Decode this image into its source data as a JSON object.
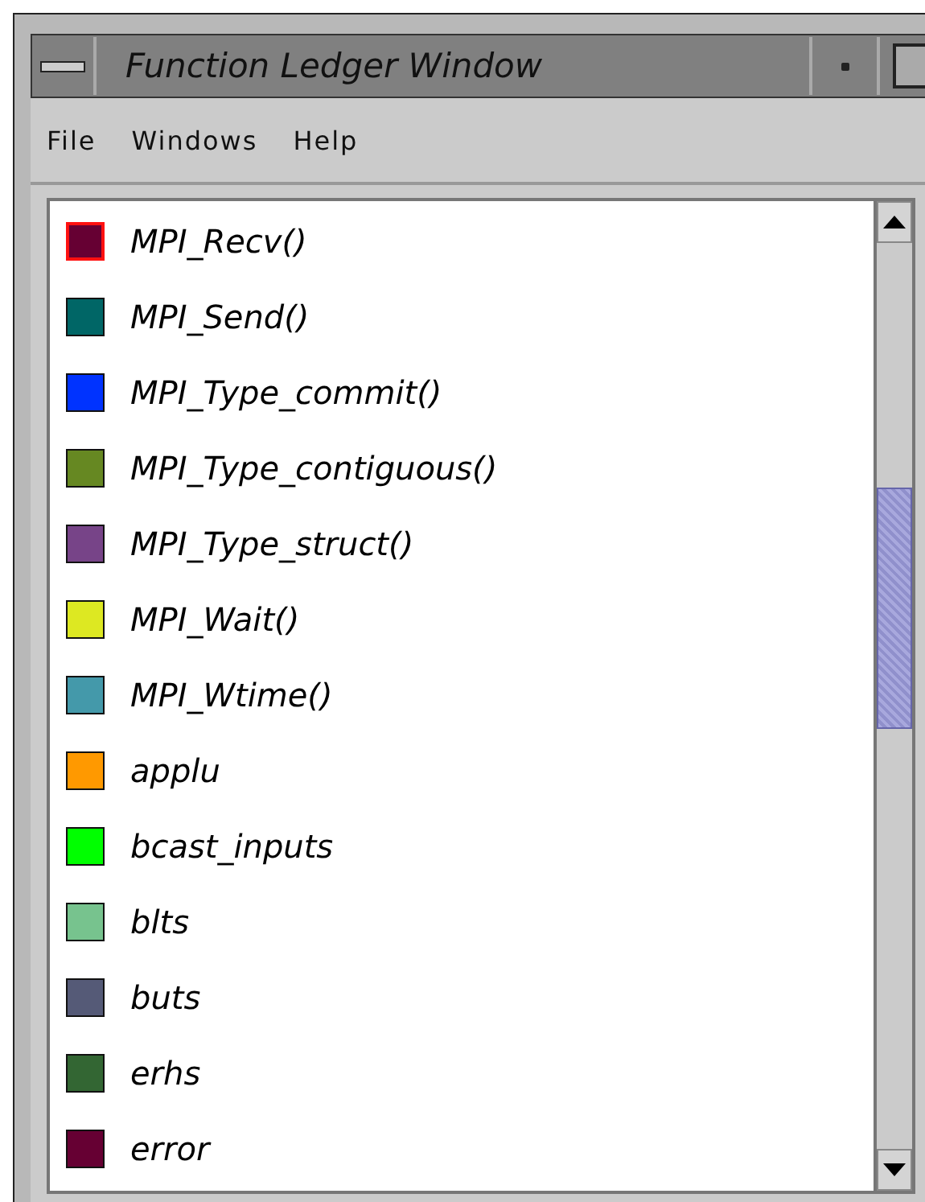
{
  "window": {
    "title": "Function Ledger Window"
  },
  "menu": [
    "File",
    "Windows",
    "Help"
  ],
  "functions": [
    {
      "name": "MPI_Recv()",
      "color": "#660033",
      "selected": true
    },
    {
      "name": "MPI_Send()",
      "color": "#006666",
      "selected": false
    },
    {
      "name": "MPI_Type_commit()",
      "color": "#0033ff",
      "selected": false
    },
    {
      "name": "MPI_Type_contiguous()",
      "color": "#668822",
      "selected": false
    },
    {
      "name": "MPI_Type_struct()",
      "color": "#774488",
      "selected": false
    },
    {
      "name": "MPI_Wait()",
      "color": "#dde822",
      "selected": false
    },
    {
      "name": "MPI_Wtime()",
      "color": "#4499aa",
      "selected": false
    },
    {
      "name": "applu",
      "color": "#ff9900",
      "selected": false
    },
    {
      "name": "bcast_inputs",
      "color": "#00ff00",
      "selected": false
    },
    {
      "name": "blts",
      "color": "#77c38e",
      "selected": false
    },
    {
      "name": "buts",
      "color": "#555a77",
      "selected": false
    },
    {
      "name": "erhs",
      "color": "#336633",
      "selected": false
    },
    {
      "name": "error",
      "color": "#660033",
      "selected": false
    }
  ]
}
